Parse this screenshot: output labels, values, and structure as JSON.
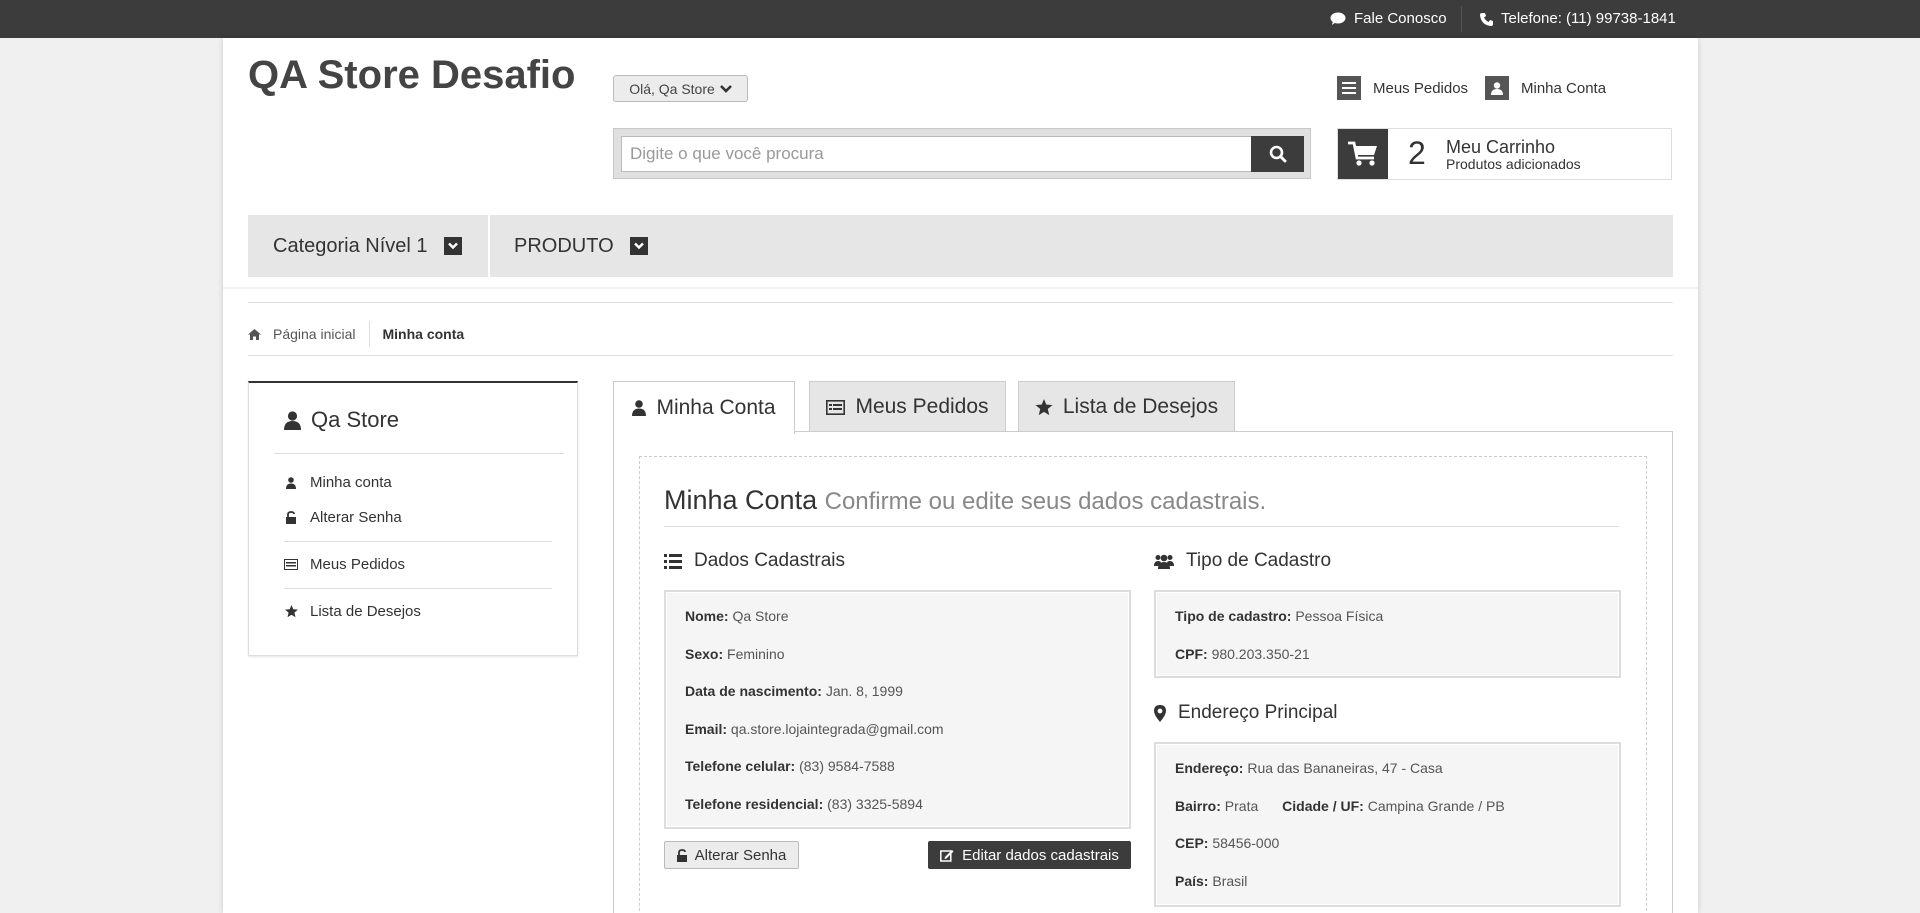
{
  "topbar": {
    "contact_label": "Fale Conosco",
    "phone_label": "Telefone: (11) 99738-1841"
  },
  "header": {
    "logo": "QA Store Desafio",
    "greeting": "Olá, Qa Store",
    "search_placeholder": "Digite o que você procura",
    "orders_link": "Meus Pedidos",
    "account_link": "Minha Conta"
  },
  "cart": {
    "count": "2",
    "title": "Meu Carrinho",
    "subtitle": "Produtos adicionados"
  },
  "category_nav": [
    {
      "label": "Categoria Nível 1"
    },
    {
      "label": "PRODUTO"
    }
  ],
  "breadcrumb": {
    "home": "Página inicial",
    "current": "Minha conta"
  },
  "sidebar": {
    "user_name": "Qa Store",
    "items": [
      {
        "label": "Minha conta",
        "icon": "user-icon"
      },
      {
        "label": "Alterar Senha",
        "icon": "unlock-icon"
      },
      {
        "label": "Meus Pedidos",
        "icon": "list-icon"
      },
      {
        "label": "Lista de Desejos",
        "icon": "star-icon"
      }
    ]
  },
  "tabs": [
    {
      "label": "Minha Conta",
      "icon": "user-icon",
      "active": true
    },
    {
      "label": "Meus Pedidos",
      "icon": "list-icon",
      "active": false
    },
    {
      "label": "Lista de Desejos",
      "icon": "star-icon",
      "active": false
    }
  ],
  "account": {
    "title": "Minha Conta",
    "subtitle": "Confirme ou edite seus dados cadastrais.",
    "personal_heading": "Dados Cadastrais",
    "personal": [
      {
        "label": "Nome:",
        "value": "Qa Store"
      },
      {
        "label": "Sexo:",
        "value": "Feminino"
      },
      {
        "label": "Data de nascimento:",
        "value": "Jan. 8, 1999"
      },
      {
        "label": "Email:",
        "value": "qa.store.lojaintegrada@gmail.com"
      },
      {
        "label": "Telefone celular:",
        "value": "(83) 9584-7588"
      },
      {
        "label": "Telefone residencial:",
        "value": "(83) 3325-5894"
      }
    ],
    "type_heading": "Tipo de Cadastro",
    "type": [
      {
        "label": "Tipo de cadastro:",
        "value": "Pessoa Física"
      },
      {
        "label": "CPF:",
        "value": "980.203.350-21"
      }
    ],
    "address_heading": "Endereço Principal",
    "address": {
      "street_label": "Endereço:",
      "street": "Rua das Bananeiras, 47 - Casa",
      "district_label": "Bairro:",
      "district": "Prata",
      "city_label": "Cidade / UF:",
      "city": "Campina Grande / PB",
      "zip_label": "CEP:",
      "zip": "58456-000",
      "country_label": "País:",
      "country": "Brasil"
    },
    "change_password_button": "Alterar Senha",
    "edit_button": "Editar dados cadastrais"
  }
}
